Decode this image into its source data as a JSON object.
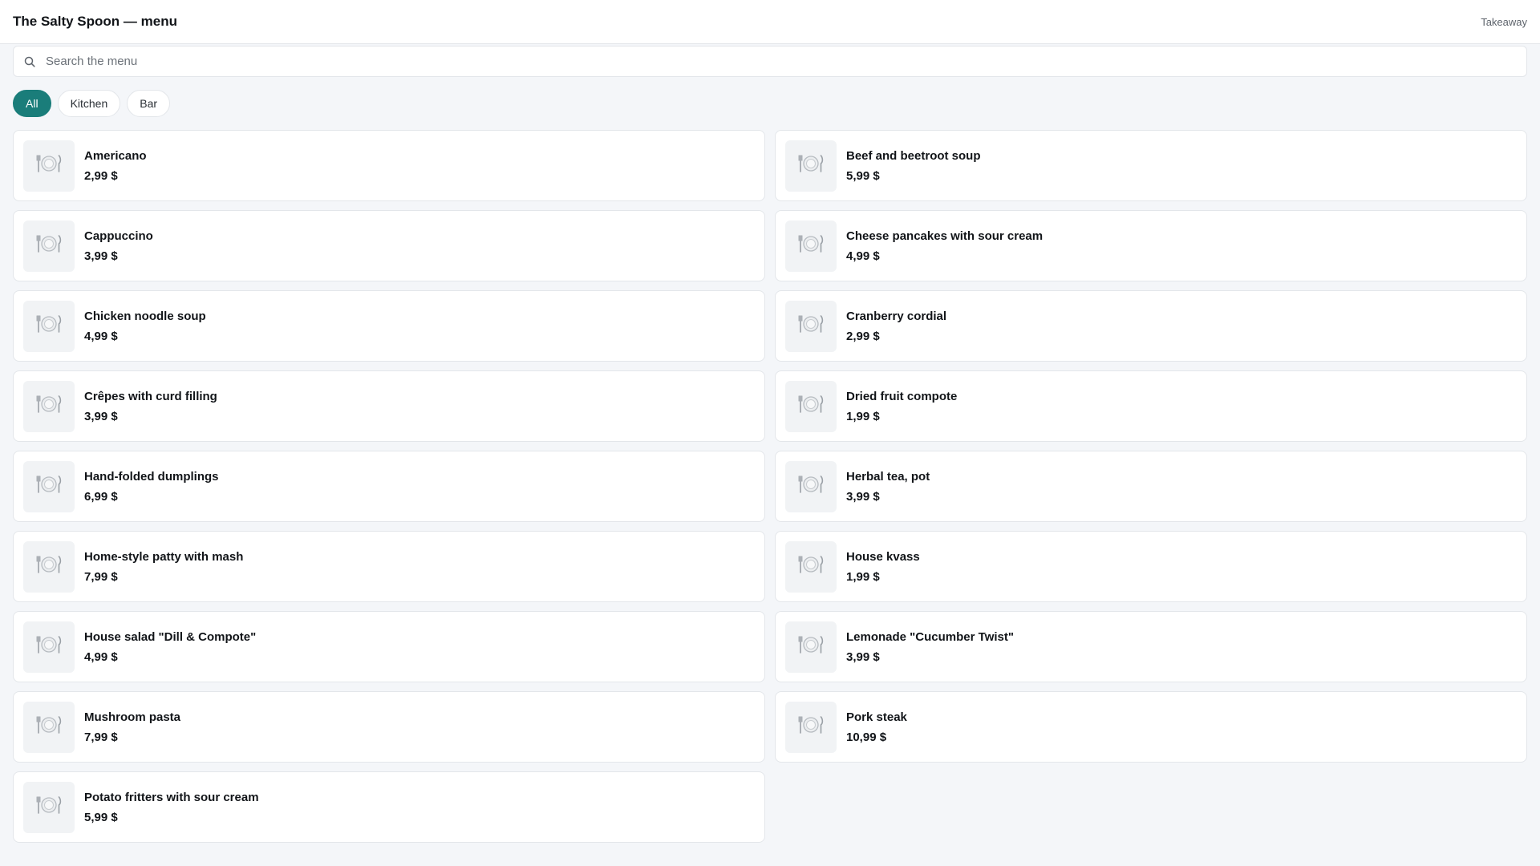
{
  "header": {
    "title": "The Salty Spoon — menu",
    "mode": "Takeaway"
  },
  "search": {
    "icon": "search-icon",
    "placeholder": "Search the menu",
    "value": ""
  },
  "filters": [
    {
      "label": "All",
      "active": true
    },
    {
      "label": "Kitchen",
      "active": false
    },
    {
      "label": "Bar",
      "active": false
    }
  ],
  "colors": {
    "accent": "#1a7d7a",
    "background": "#f4f6f9",
    "card": "#ffffff"
  },
  "item_icon": "plate-cutlery-icon",
  "items": [
    {
      "name": "Americano",
      "price": "2,99 $"
    },
    {
      "name": "Beef and beetroot soup",
      "price": "5,99 $"
    },
    {
      "name": "Cappuccino",
      "price": "3,99 $"
    },
    {
      "name": "Cheese pancakes with sour cream",
      "price": "4,99 $"
    },
    {
      "name": "Chicken noodle soup",
      "price": "4,99 $"
    },
    {
      "name": "Cranberry cordial",
      "price": "2,99 $"
    },
    {
      "name": "Crêpes with curd filling",
      "price": "3,99 $"
    },
    {
      "name": "Dried fruit compote",
      "price": "1,99 $"
    },
    {
      "name": "Hand-folded dumplings",
      "price": "6,99 $"
    },
    {
      "name": "Herbal tea, pot",
      "price": "3,99 $"
    },
    {
      "name": "Home-style patty with mash",
      "price": "7,99 $"
    },
    {
      "name": "House kvass",
      "price": "1,99 $"
    },
    {
      "name": "House salad \"Dill & Compote\"",
      "price": "4,99 $"
    },
    {
      "name": "Lemonade \"Cucumber Twist\"",
      "price": "3,99 $"
    },
    {
      "name": "Mushroom pasta",
      "price": "7,99 $"
    },
    {
      "name": "Pork steak",
      "price": "10,99 $"
    },
    {
      "name": "Potato fritters with sour cream",
      "price": "5,99 $"
    }
  ]
}
